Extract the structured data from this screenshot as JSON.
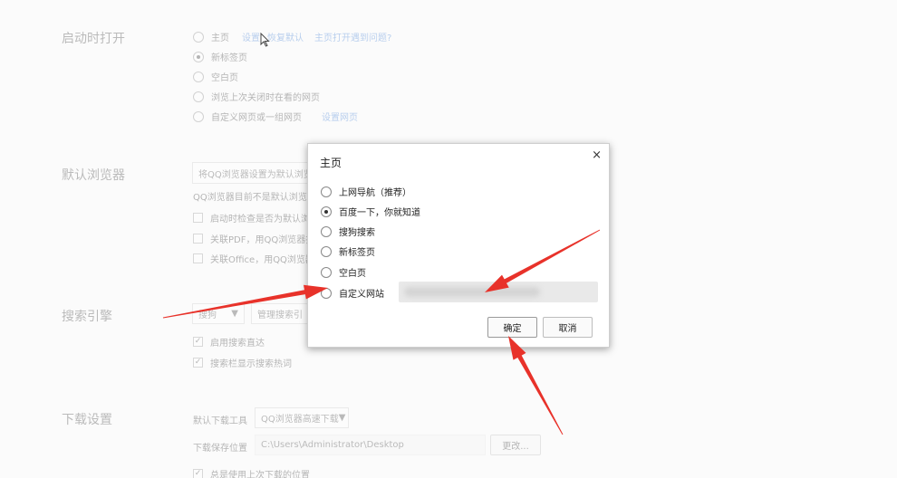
{
  "settings": {
    "startup": {
      "title": "启动时打开",
      "homepage": "主页",
      "set": "设置",
      "restore": "恢复默认",
      "problem": "主页打开遇到问题?",
      "new_tab": "新标签页",
      "blank": "空白页",
      "last_session": "浏览上次关闭时在看的网页",
      "custom": "自定义网页或一组网页",
      "custom_link": "设置网页"
    },
    "default_browser": {
      "title": "默认浏览器",
      "set_default": "将QQ浏览器设置为默认浏览",
      "status": "QQ浏览器目前不是默认浏览器",
      "check_start": "启动时检查是否为默认浏",
      "pdf": "关联PDF，用QQ浏览器打",
      "office": "关联Office，用QQ浏览器"
    },
    "search": {
      "title": "搜索引擎",
      "engine": "搜狗",
      "manage": "管理搜索引",
      "suggest": "启用搜索直达",
      "hotwords": "搜索栏显示搜索热词"
    },
    "download": {
      "title": "下载设置",
      "tool_label": "默认下载工具",
      "tool_value": "QQ浏览器高速下载",
      "path_label": "下载保存位置",
      "path_value": "C:\\Users\\Administrator\\Desktop",
      "change": "更改...",
      "last_location": "总是使用上次下载的位置"
    }
  },
  "dialog": {
    "title": "主页",
    "close": "×",
    "options": [
      "上网导航（推荐）",
      "百度一下，你就知道",
      "搜狗搜索",
      "新标签页",
      "空白页",
      "自定义网站"
    ],
    "selected_index": 1,
    "ok": "确定",
    "cancel": "取消"
  },
  "colors": {
    "link": "#3a7bd5",
    "arrow": "#e8322a"
  },
  "icons": {
    "cursor": "mouse-pointer-icon",
    "dropdown": "triangle-down-icon",
    "check": "checkmark-icon"
  }
}
